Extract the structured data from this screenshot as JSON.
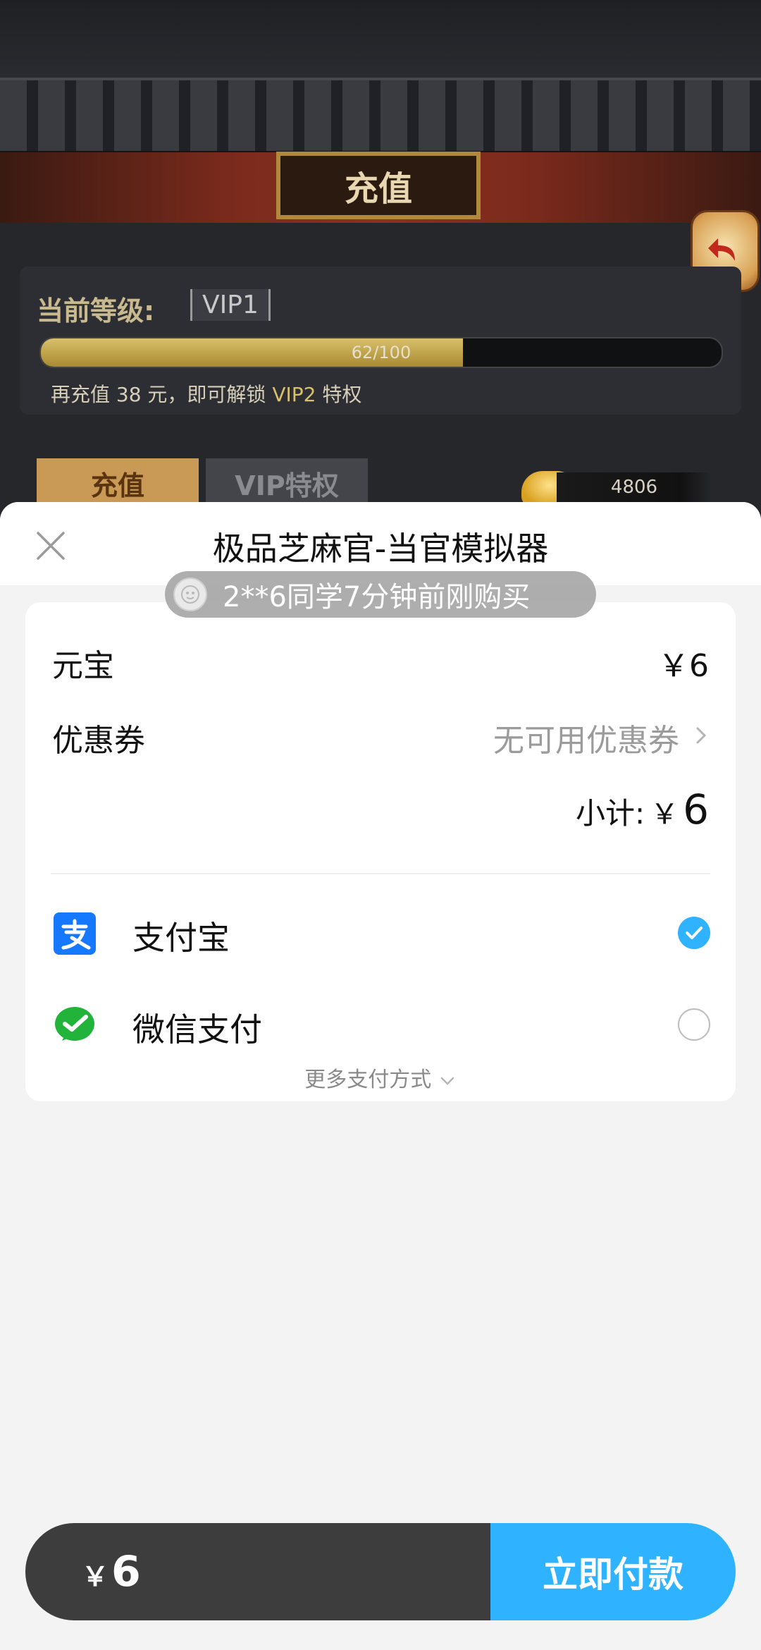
{
  "game": {
    "title": "充值",
    "vip_label": "当前等级:",
    "vip_level": "VIP1",
    "progress_text": "62/100",
    "progress_fraction": 0.62,
    "hint_prefix": "再充值 38 元，即可解锁",
    "hint_vip": "VIP2",
    "hint_suffix": "特权",
    "tab_recharge": "充值",
    "tab_vip": "VIP特权",
    "coins": "4806"
  },
  "sheet": {
    "title": "极品芝麻官-当官模拟器",
    "ticker": "2**6同学7分钟前刚购买",
    "item_label": "元宝",
    "item_price": "￥6",
    "coupon_label": "优惠券",
    "coupon_value": "无可用优惠券",
    "subtotal_label": "小计:",
    "subtotal_symbol": "￥",
    "subtotal_amount": "6",
    "payment_methods": [
      {
        "label": "支付宝",
        "icon": "alipay-icon",
        "selected": true,
        "color": "#1677ff"
      },
      {
        "label": "微信支付",
        "icon": "wechat-pay-icon",
        "selected": false,
        "color": "#22b33a"
      }
    ],
    "more_methods": "更多支付方式"
  },
  "bottom": {
    "symbol": "￥",
    "amount": "6",
    "pay_button": "立即付款"
  },
  "colors": {
    "accent": "#2fb2ff",
    "bar_dark": "#3d3d3d"
  }
}
